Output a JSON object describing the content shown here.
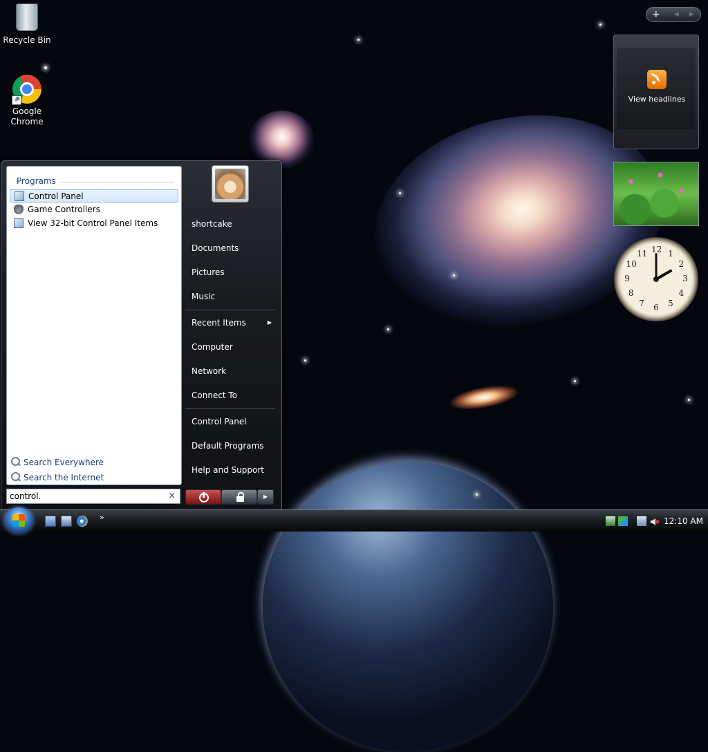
{
  "desktop": {
    "icons": [
      {
        "label": "Recycle Bin"
      },
      {
        "label": "Google\nChrome"
      }
    ]
  },
  "start_menu": {
    "left_pane": {
      "group_header": "Programs",
      "results": [
        {
          "label": "Control Panel",
          "selected": true,
          "icon": "control-panel-icon"
        },
        {
          "label": "Game Controllers",
          "selected": false,
          "icon": "game-controller-icon"
        },
        {
          "label": "View 32-bit Control Panel Items",
          "selected": false,
          "icon": "control-panel-icon"
        }
      ],
      "search_links": [
        {
          "label": "Search Everywhere",
          "icon": "search-icon"
        },
        {
          "label": "Search the Internet",
          "icon": "search-icon"
        }
      ]
    },
    "search": {
      "value": "control.",
      "clear_glyph": "×"
    },
    "right_pane": {
      "user_name": "shortcake",
      "items": [
        {
          "label": "Documents"
        },
        {
          "label": "Pictures"
        },
        {
          "label": "Music"
        },
        {
          "label": "Recent Items",
          "submenu": true
        },
        {
          "label": "Computer"
        },
        {
          "label": "Network"
        },
        {
          "label": "Connect To"
        },
        {
          "label": "Control Panel"
        },
        {
          "label": "Default Programs"
        },
        {
          "label": "Help and Support"
        }
      ]
    },
    "power": {
      "arrow_glyph": "▶"
    }
  },
  "taskbar": {
    "quick_launch_more": "»",
    "clock": "12:10 AM"
  },
  "sidebar": {
    "controls": {
      "add_glyph": "+",
      "nav_glyphs": "◀ ▶"
    },
    "feed_gadget": {
      "label": "View headlines"
    },
    "clock_gadget": {
      "hour": 2,
      "minute": 0,
      "numbers": [
        "12",
        "1",
        "2",
        "3",
        "4",
        "5",
        "6",
        "7",
        "8",
        "9",
        "10",
        "11"
      ]
    }
  },
  "colors": {
    "selection": "#d3e8fb",
    "link": "#1e3e78",
    "power_red": "#c54f4f"
  }
}
